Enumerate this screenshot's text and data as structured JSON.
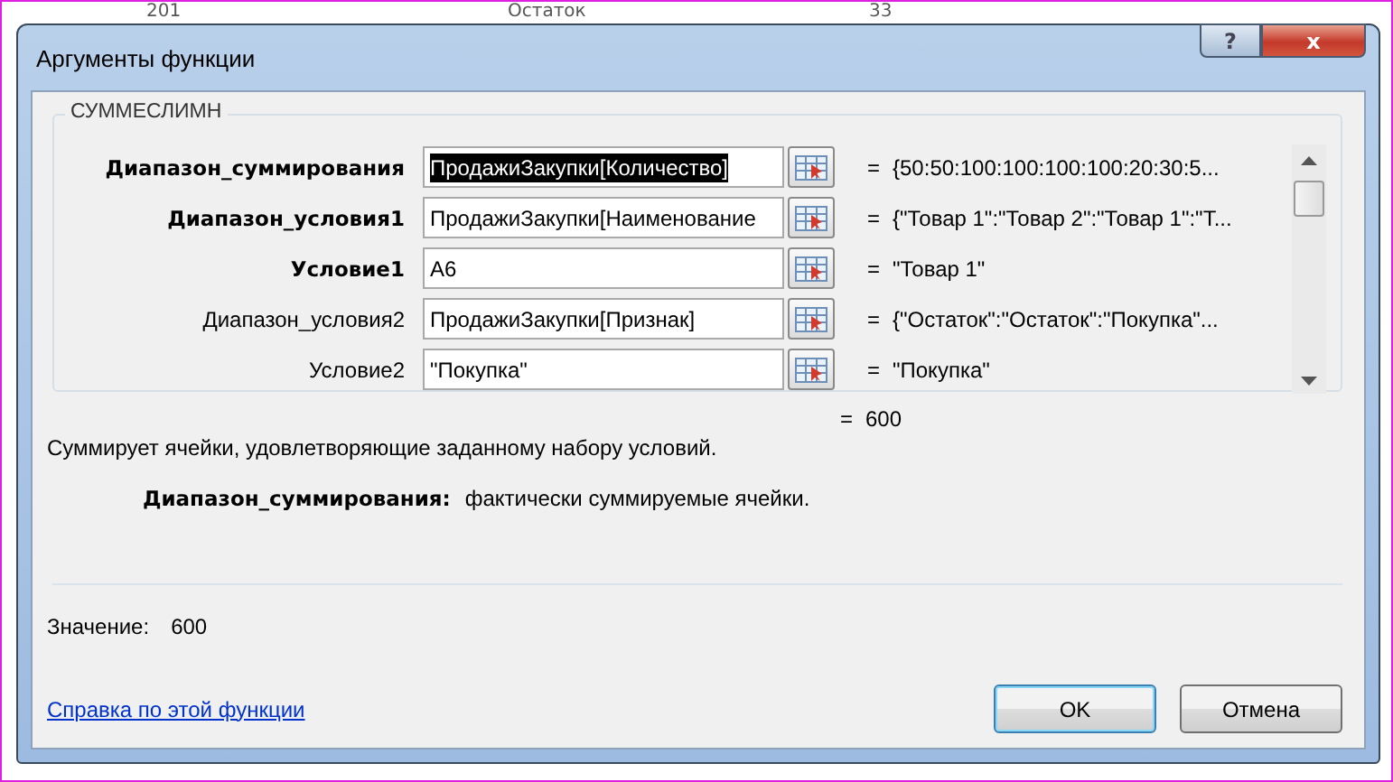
{
  "background_sheet": {
    "cells": [
      "201",
      "Остаток",
      "33"
    ]
  },
  "window": {
    "title": "Аргументы функции",
    "help_button": "?",
    "close_button": "x"
  },
  "function_group": {
    "title": "СУММЕСЛИМН",
    "arguments": [
      {
        "label": "Диапазон_суммирования",
        "required": true,
        "value": "ПродажиЗакупки[Количество]",
        "selected": true,
        "sign": "=",
        "result": "{50:50:100:100:100:100:20:30:5..."
      },
      {
        "label": "Диапазон_условия1",
        "required": true,
        "value": "ПродажиЗакупки[Наименование",
        "selected": false,
        "sign": "=",
        "result": "{\"Товар 1\":\"Товар 2\":\"Товар 1\":\"Т..."
      },
      {
        "label": "Условие1",
        "required": true,
        "value": "A6",
        "selected": false,
        "sign": "=",
        "result": "\"Товар 1\""
      },
      {
        "label": "Диапазон_условия2",
        "required": false,
        "value": "ПродажиЗакупки[Признак]",
        "selected": false,
        "sign": "=",
        "result": "{\"Остаток\":\"Остаток\":\"Покупка\"..."
      },
      {
        "label": "Условие2",
        "required": false,
        "value": "\"Покупка\"",
        "selected": false,
        "sign": "=",
        "result": "\"Покупка\""
      }
    ]
  },
  "formula_result": {
    "sign": "=",
    "text": "600"
  },
  "description": "Суммирует ячейки, удовлетворяющие заданному набору условий.",
  "argument_help": {
    "name": "Диапазон_суммирования:",
    "text": "фактически суммируемые ячейки."
  },
  "value": {
    "label": "Значение:",
    "text": "600"
  },
  "help_link": "Справка по этой функции",
  "buttons": [
    {
      "label": "OK",
      "default": true
    },
    {
      "label": "Отмена",
      "default": false
    }
  ]
}
